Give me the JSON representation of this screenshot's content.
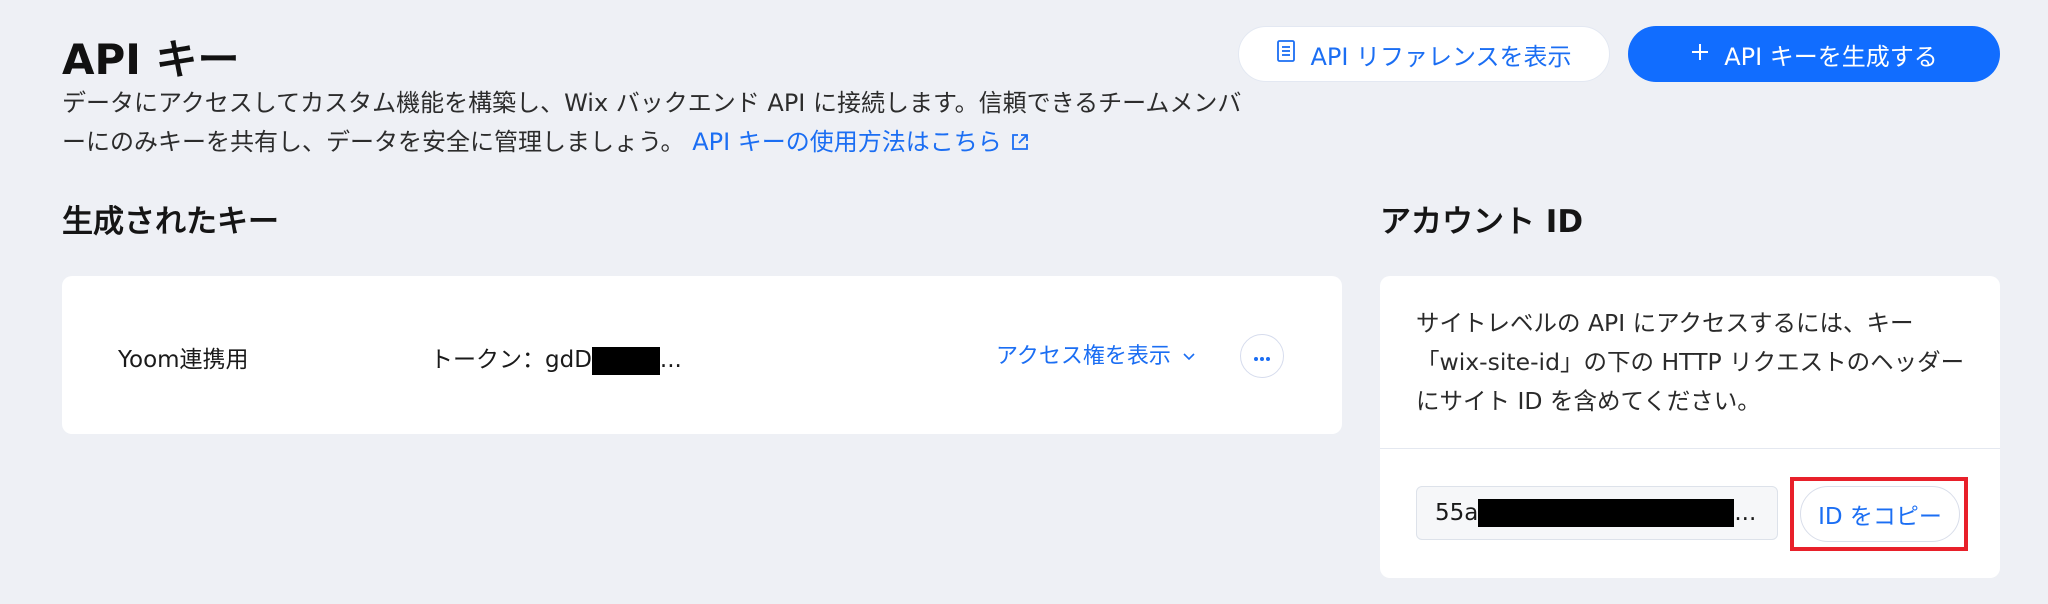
{
  "header": {
    "title": "API キー",
    "description": "データにアクセスしてカスタム機能を構築し、Wix バックエンド API に接続します。信頼できるチームメンバーにのみキーを共有し、データを安全に管理しましょう。",
    "learn_link": "API キーの使用方法はこちら",
    "ref_button": "API リファレンスを表示",
    "create_button": "API キーを生成する"
  },
  "keys_section": {
    "title": "生成されたキー",
    "items": [
      {
        "name": "Yoom連携用",
        "token_label": "トークン：",
        "token_prefix": "gdD",
        "token_suffix": "...",
        "access_link": "アクセス権を表示"
      }
    ]
  },
  "account_section": {
    "title": "アカウント ID",
    "description": "サイトレベルの API にアクセスするには、キー「wix-site-id」の下の HTTP リクエストのヘッダーにサイト ID を含めてください。",
    "id_prefix": "55a",
    "id_suffix": "...",
    "copy_button": "ID をコピー"
  },
  "colors": {
    "accent": "#116dff",
    "link": "#1b6ef3",
    "background": "#eef0f5",
    "highlight": "#e8202a"
  },
  "icons": {
    "ref_button": "document-icon",
    "create_button": "plus-icon",
    "learn_link": "external-link-icon",
    "access_link": "chevron-down-icon",
    "more_button": "more-horizontal-icon"
  }
}
